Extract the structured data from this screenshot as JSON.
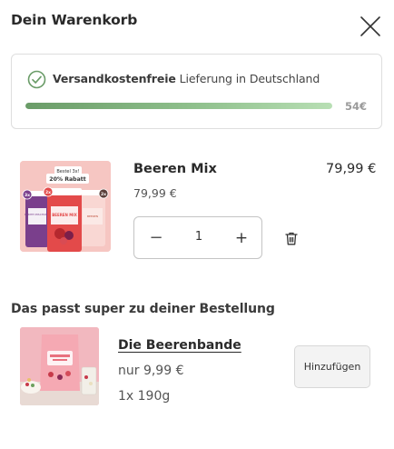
{
  "cart": {
    "title": "Dein Warenkorb",
    "close_icon": "close-icon"
  },
  "shipping": {
    "bold_text": "Versandkostenfreie",
    "text": " Lieferung in Deutschland",
    "threshold": "54€",
    "progress_fraction": 1.0,
    "icon": "check-circle-icon",
    "color": "#6a9c68"
  },
  "item": {
    "name": "Beeren Mix",
    "unit_price": "79,99 €",
    "total_price": "79,99 €",
    "quantity": "1",
    "minus_label": "−",
    "plus_label": "+",
    "delete_icon": "trash-icon",
    "image_badge": "Bestel 3x!",
    "image_discount": "20% Rabatt",
    "image_labels": [
      "3x",
      "2x",
      "2x"
    ],
    "image_jar_labels": [
      "BUNTE MISCHUNG",
      "BEEREN MIX",
      "BEEREN"
    ]
  },
  "upsell": {
    "title": "Das passt super zu deiner Bestellung",
    "product_name": "Die Beerenbande",
    "price": "nur 9,99 €",
    "size": "1x 190g",
    "button_label": "Hinzufügen"
  }
}
